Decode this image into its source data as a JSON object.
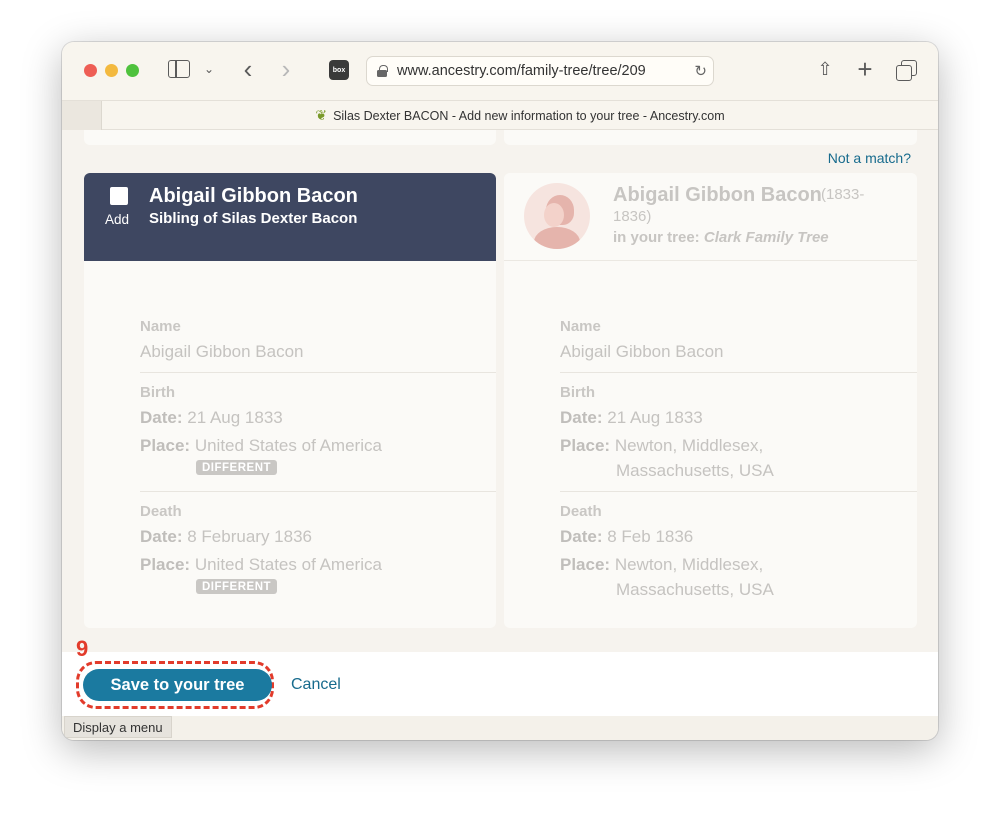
{
  "browser": {
    "url": "www.ancestry.com/family-tree/tree/209",
    "tab_title": "Silas Dexter BACON - Add new information to your tree - Ancestry.com",
    "pinned_tab": "apple-icon",
    "extension_label": "box",
    "status_tip": "Display a menu"
  },
  "not_a_match": "Not a match?",
  "left_card": {
    "add_label": "Add",
    "name": "Abigail Gibbon Bacon",
    "relation": "Sibling of Silas Dexter Bacon",
    "name_label": "Name",
    "name_value": "Abigail Gibbon Bacon",
    "birth_label": "Birth",
    "birth_date_label": "Date:",
    "birth_date": "21 Aug 1833",
    "birth_place_label": "Place:",
    "birth_place": "United States of America",
    "birth_badge": "DIFFERENT",
    "death_label": "Death",
    "death_date_label": "Date:",
    "death_date": "8 February 1836",
    "death_place_label": "Place:",
    "death_place": "United States of America",
    "death_badge": "DIFFERENT"
  },
  "right_card": {
    "name": "Abigail Gibbon Bacon",
    "years_line1": "(1833-",
    "years_line2": "1836)",
    "in_tree_label": "in your tree:",
    "tree_name": "Clark Family Tree",
    "name_label": "Name",
    "name_value": "Abigail Gibbon Bacon",
    "birth_label": "Birth",
    "birth_date_label": "Date:",
    "birth_date": "21 Aug 1833",
    "birth_place_label": "Place:",
    "birth_place_line1": "Newton, Middlesex,",
    "birth_place_line2": "Massachusetts, USA",
    "death_label": "Death",
    "death_date_label": "Date:",
    "death_date": "8 Feb 1836",
    "death_place_label": "Place:",
    "death_place_line1": "Newton, Middlesex,",
    "death_place_line2": "Massachusetts, USA"
  },
  "footer": {
    "step_number": "9",
    "save_label": "Save to your tree",
    "cancel_label": "Cancel"
  },
  "colors": {
    "header_navy": "#3e4761",
    "primary_button": "#1b7aa0",
    "link": "#176b8d",
    "annotation_red": "#e23b2b"
  }
}
